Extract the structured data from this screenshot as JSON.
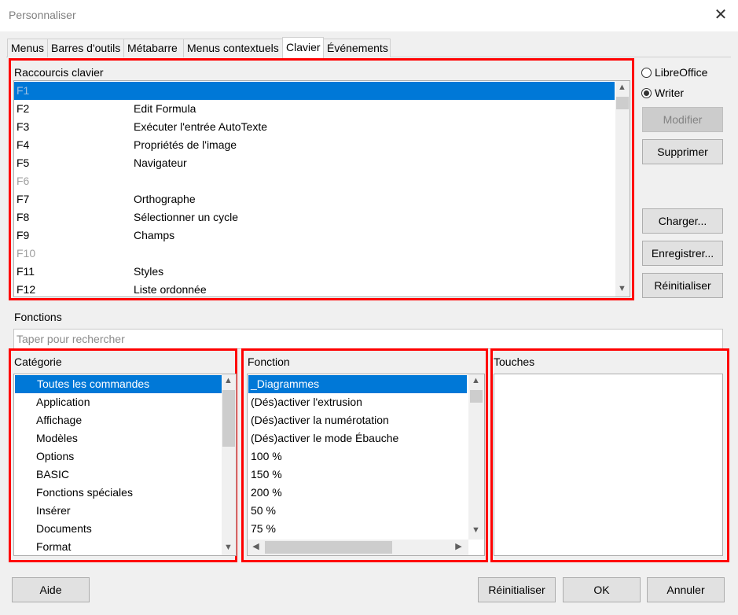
{
  "window": {
    "title": "Personnaliser"
  },
  "tabs": [
    "Menus",
    "Barres d'outils",
    "Métabarre",
    "Menus contextuels",
    "Clavier",
    "Événements"
  ],
  "shortcuts": {
    "label": "Raccourcis clavier",
    "rows": [
      {
        "key": "F1",
        "function": ""
      },
      {
        "key": "F2",
        "function": "Edit Formula"
      },
      {
        "key": "F3",
        "function": "Exécuter l'entrée AutoTexte"
      },
      {
        "key": "F4",
        "function": "Propriétés de l'image"
      },
      {
        "key": "F5",
        "function": "Navigateur"
      },
      {
        "key": "F6",
        "function": ""
      },
      {
        "key": "F7",
        "function": "Orthographe"
      },
      {
        "key": "F8",
        "function": "Sélectionner un cycle"
      },
      {
        "key": "F9",
        "function": "Champs"
      },
      {
        "key": "F10",
        "function": ""
      },
      {
        "key": "F11",
        "function": "Styles"
      },
      {
        "key": "F12",
        "function": "Liste ordonnée"
      }
    ]
  },
  "scope": {
    "libreoffice": "LibreOffice",
    "writer": "Writer"
  },
  "buttons": {
    "modify": "Modifier",
    "delete": "Supprimer",
    "load": "Charger...",
    "save": "Enregistrer...",
    "reset_side": "Réinitialiser",
    "help": "Aide",
    "reset": "Réinitialiser",
    "ok": "OK",
    "cancel": "Annuler"
  },
  "functions_section": {
    "label": "Fonctions",
    "search_placeholder": "Taper pour rechercher"
  },
  "category": {
    "label": "Catégorie",
    "items": [
      "Toutes les commandes",
      "Application",
      "Affichage",
      "Modèles",
      "Options",
      "BASIC",
      "Fonctions spéciales",
      "Insérer",
      "Documents",
      "Format"
    ]
  },
  "function": {
    "label": "Fonction",
    "items": [
      "_Diagrammes",
      "(Dés)activer l'extrusion",
      "(Dés)activer la numérotation",
      "(Dés)activer le mode Ébauche",
      "100 %",
      "150 %",
      "200 %",
      "50 %",
      "75 %"
    ]
  },
  "keys": {
    "label": "Touches"
  },
  "colors": {
    "accent": "#0078d7",
    "highlight_border": "#ff0000"
  }
}
